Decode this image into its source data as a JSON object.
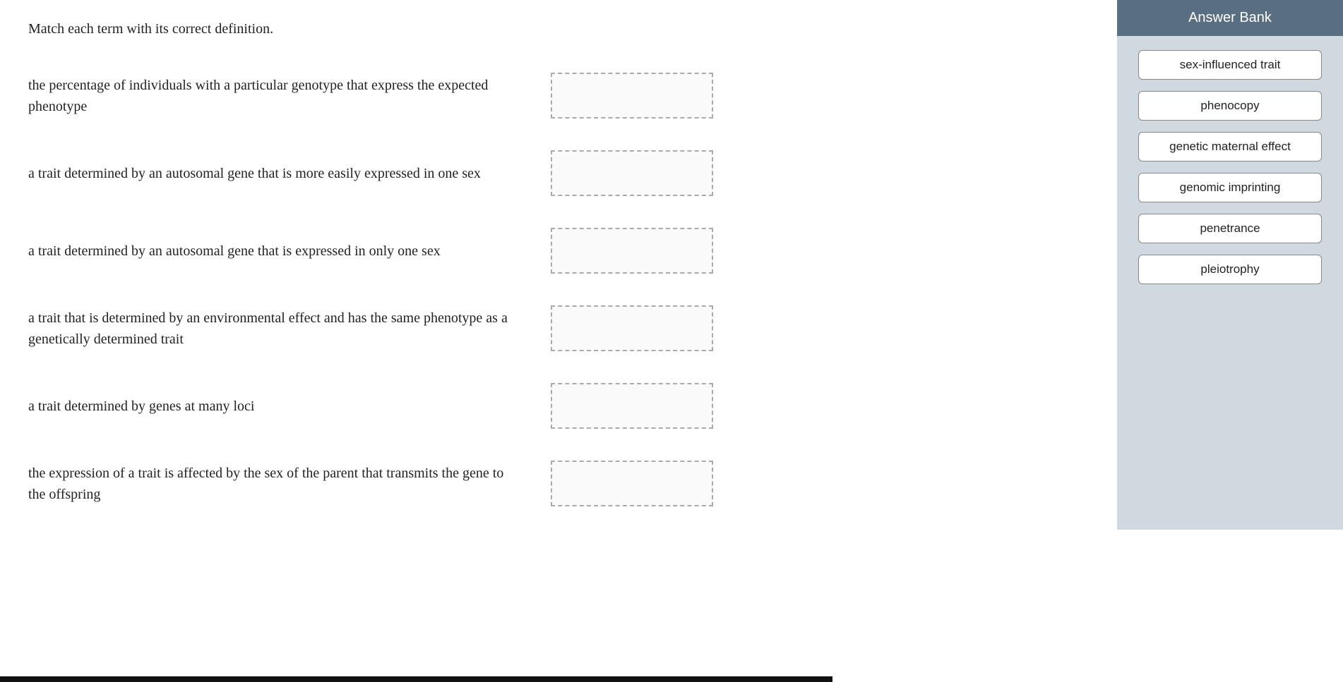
{
  "instructions": "Match each term with its correct definition.",
  "rows": [
    {
      "id": "row-1",
      "definition": "the percentage of individuals with a particular genotype that express the expected phenotype"
    },
    {
      "id": "row-2",
      "definition": "a trait determined by an autosomal gene that is more easily expressed in one sex"
    },
    {
      "id": "row-3",
      "definition": "a trait determined by an autosomal gene that is expressed in only one sex"
    },
    {
      "id": "row-4",
      "definition": "a trait that is determined by an environmental effect and has the same phenotype as a genetically determined trait"
    },
    {
      "id": "row-5",
      "definition": "a trait determined by genes at many loci"
    },
    {
      "id": "row-6",
      "definition": "the expression of a trait is affected by the sex of the parent that transmits the gene to the offspring"
    }
  ],
  "answer_bank": {
    "header": "Answer Bank",
    "items": [
      {
        "id": "chip-1",
        "label": "sex-influenced trait"
      },
      {
        "id": "chip-2",
        "label": "phenocopy"
      },
      {
        "id": "chip-3",
        "label": "genetic maternal effect"
      },
      {
        "id": "chip-4",
        "label": "genomic imprinting"
      },
      {
        "id": "chip-5",
        "label": "penetrance"
      },
      {
        "id": "chip-6",
        "label": "pleiotrophy"
      }
    ]
  }
}
